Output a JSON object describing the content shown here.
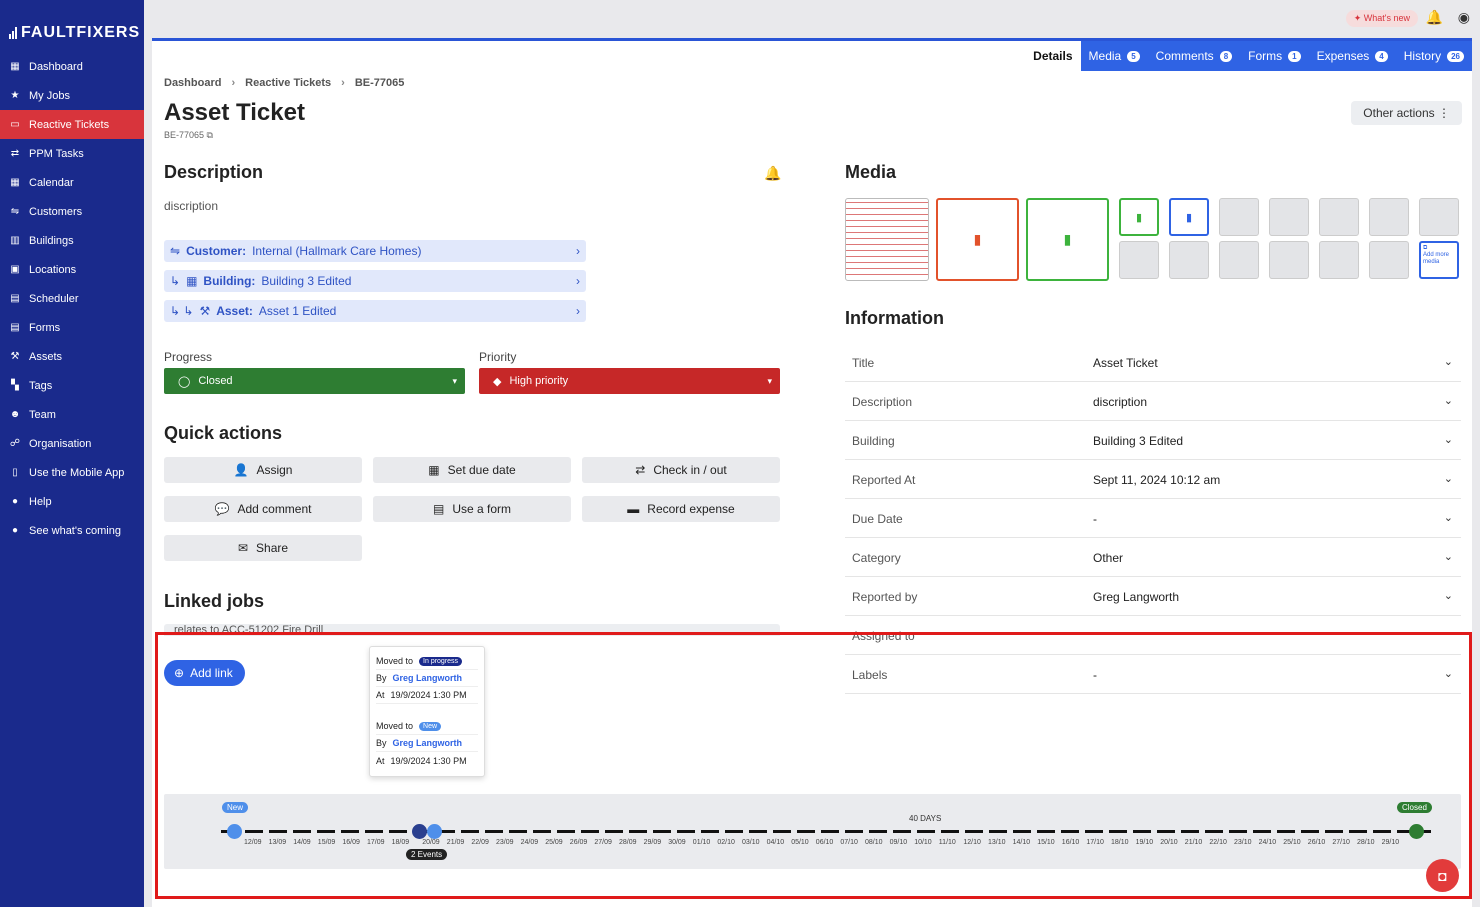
{
  "brand": "FAULTFIXERS",
  "sidebar": {
    "items": [
      {
        "label": "Dashboard",
        "icon": "dashboard-icon"
      },
      {
        "label": "My Jobs",
        "icon": "star-icon"
      },
      {
        "label": "Reactive Tickets",
        "icon": "ticket-icon"
      },
      {
        "label": "PPM Tasks",
        "icon": "arrows-icon"
      },
      {
        "label": "Calendar",
        "icon": "calendar-icon"
      },
      {
        "label": "Customers",
        "icon": "handshake-icon"
      },
      {
        "label": "Buildings",
        "icon": "building-icon"
      },
      {
        "label": "Locations",
        "icon": "location-icon"
      },
      {
        "label": "Scheduler",
        "icon": "scheduler-icon"
      },
      {
        "label": "Forms",
        "icon": "form-icon"
      },
      {
        "label": "Assets",
        "icon": "hammer-icon"
      },
      {
        "label": "Tags",
        "icon": "tags-icon"
      },
      {
        "label": "Team",
        "icon": "team-icon"
      },
      {
        "label": "Organisation",
        "icon": "org-icon"
      },
      {
        "label": "Use the Mobile App",
        "icon": "mobile-icon"
      },
      {
        "label": "Help",
        "icon": "help-icon"
      },
      {
        "label": "See what's coming",
        "icon": "chat-icon"
      }
    ]
  },
  "topbar": {
    "whats_new": "What's new"
  },
  "tabs": [
    {
      "label": "Details",
      "count": ""
    },
    {
      "label": "Media",
      "count": "5"
    },
    {
      "label": "Comments",
      "count": "8"
    },
    {
      "label": "Forms",
      "count": "1"
    },
    {
      "label": "Expenses",
      "count": "4"
    },
    {
      "label": "History",
      "count": "26"
    }
  ],
  "breadcrumb": [
    "Dashboard",
    "Reactive Tickets",
    "BE-77065"
  ],
  "page": {
    "title": "Asset Ticket",
    "id": "BE-77065",
    "other_actions": "Other actions"
  },
  "description": {
    "heading": "Description",
    "text": "discription"
  },
  "links": [
    {
      "label": "Customer:",
      "value": "Internal (Hallmark Care Homes)"
    },
    {
      "label": "Building:",
      "value": "Building 3 Edited"
    },
    {
      "label": "Asset:",
      "value": "Asset 1 Edited"
    }
  ],
  "progress": {
    "label": "Progress",
    "value": "Closed",
    "color": "#2e7d32"
  },
  "priority": {
    "label": "Priority",
    "value": "High priority",
    "color": "#c62828"
  },
  "quick_actions": {
    "heading": "Quick actions",
    "buttons": [
      "Assign",
      "Set due date",
      "Check in / out",
      "Add comment",
      "Use a form",
      "Record expense",
      "Share"
    ]
  },
  "linked_jobs": {
    "heading": "Linked jobs",
    "row_text": "relates to ACC-51202 Fire Drill",
    "add_link": "Add link"
  },
  "tooltip": {
    "events": [
      {
        "moved_label": "Moved to",
        "status": "In progress",
        "status_color": "#1a2a8c",
        "by_label": "By",
        "by": "Greg Langworth",
        "at_label": "At",
        "at": "19/9/2024 1:30 PM"
      },
      {
        "moved_label": "Moved to",
        "status": "New",
        "status_color": "#4f8fea",
        "by_label": "By",
        "by": "Greg Langworth",
        "at_label": "At",
        "at": "19/9/2024 1:30 PM"
      }
    ]
  },
  "media": {
    "heading": "Media",
    "add_more": "Add more media"
  },
  "information": {
    "heading": "Information",
    "rows": [
      {
        "key": "Title",
        "value": "Asset Ticket"
      },
      {
        "key": "Description",
        "value": "discription"
      },
      {
        "key": "Building",
        "value": "Building 3 Edited"
      },
      {
        "key": "Reported At",
        "value": "Sept 11, 2024 10:12 am"
      },
      {
        "key": "Due Date",
        "value": "-"
      },
      {
        "key": "Category",
        "value": "Other"
      },
      {
        "key": "Reported by",
        "value": "Greg Langworth"
      },
      {
        "key": "Assigned to",
        "value": ""
      },
      {
        "key": "Labels",
        "value": "-"
      }
    ]
  },
  "timeline": {
    "start_label": "New",
    "end_label": "Closed",
    "days_label": "40 DAYS",
    "events_label": "2 Events",
    "ticks": [
      "12/09",
      "13/09",
      "14/09",
      "15/09",
      "16/09",
      "17/09",
      "18/09",
      "20/09",
      "21/09",
      "22/09",
      "23/09",
      "24/09",
      "25/09",
      "26/09",
      "27/09",
      "28/09",
      "29/09",
      "30/09",
      "01/10",
      "02/10",
      "03/10",
      "04/10",
      "05/10",
      "06/10",
      "07/10",
      "08/10",
      "09/10",
      "10/10",
      "11/10",
      "12/10",
      "13/10",
      "14/10",
      "15/10",
      "16/10",
      "17/10",
      "18/10",
      "19/10",
      "20/10",
      "21/10",
      "22/10",
      "23/10",
      "24/10",
      "25/10",
      "26/10",
      "27/10",
      "28/10",
      "29/10"
    ]
  }
}
